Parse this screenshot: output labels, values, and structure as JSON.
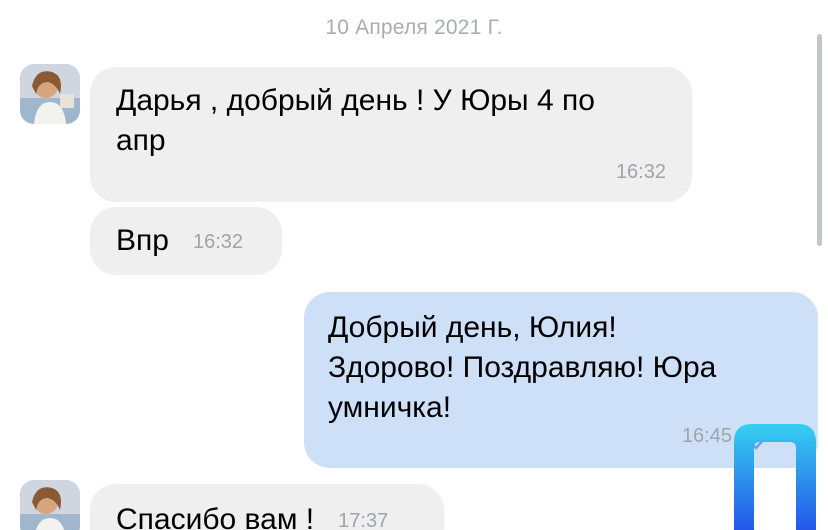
{
  "date_separator": "10 Апреля 2021 Г.",
  "messages": [
    {
      "text": "Дарья , добрый день ! У Юры 4 по\nапр",
      "time": "16:32"
    },
    {
      "text": "Впр",
      "time": "16:32"
    },
    {
      "text": "Добрый день, Юлия!\nЗдорово! Поздравляю! Юра\nумничка!",
      "time": "16:45"
    },
    {
      "text": "Спасибо вам !",
      "time": "17:37"
    }
  ],
  "icons": {
    "avatar": "contact-avatar",
    "read_receipt": "double-check-icon",
    "watermark": "blue-logo-mark"
  },
  "colors": {
    "incoming_bubble": "#efefef",
    "outgoing_bubble": "#cde0f8",
    "timestamp": "#a0a4a9",
    "date": "#a9adb3",
    "read_check": "#6f9fe0",
    "logo": "#2d6ff0"
  }
}
